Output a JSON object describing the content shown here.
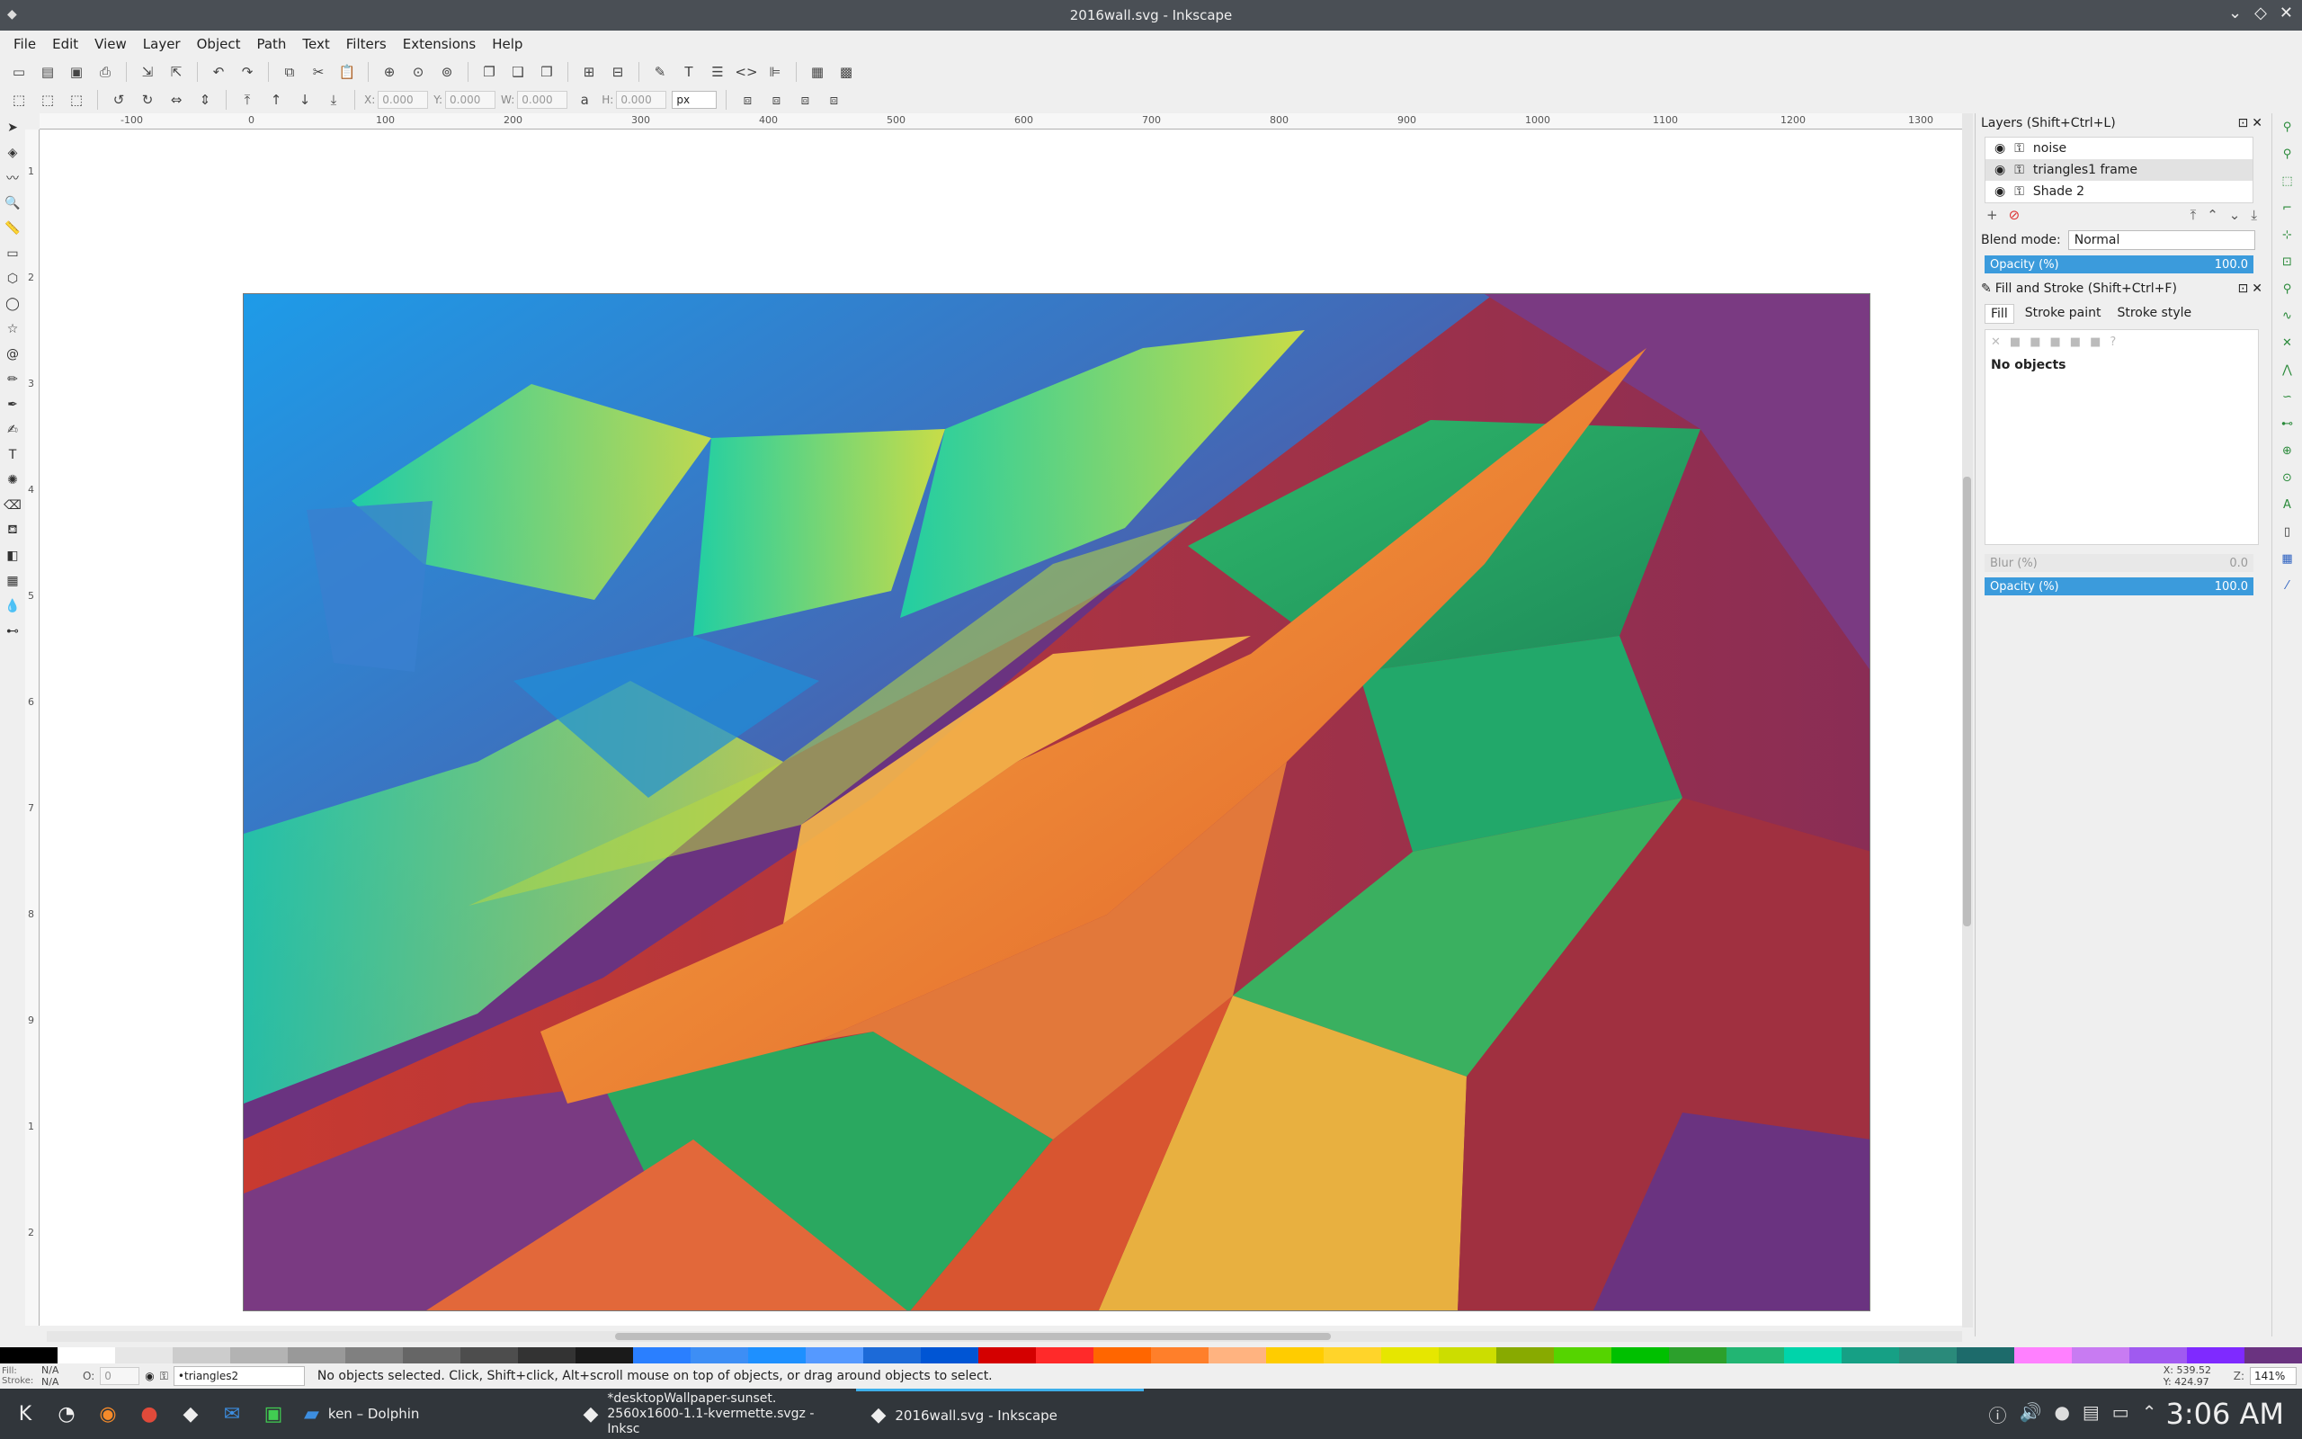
{
  "window": {
    "title": "2016wall.svg - Inkscape"
  },
  "menu": [
    "File",
    "Edit",
    "View",
    "Layer",
    "Object",
    "Path",
    "Text",
    "Filters",
    "Extensions",
    "Help"
  ],
  "controls": {
    "x_label": "X:",
    "x_value": "0.000",
    "y_label": "Y:",
    "y_value": "0.000",
    "w_label": "W:",
    "w_value": "0.000",
    "h_label": "H:",
    "h_value": "0.000",
    "unit": "px"
  },
  "ruler": {
    "h_ticks": [
      "-100",
      "0",
      "100",
      "200",
      "300",
      "400",
      "500",
      "600",
      "700",
      "800",
      "900",
      "1000",
      "1100",
      "1200",
      "1300"
    ],
    "v_ticks": [
      "1",
      "2",
      "3",
      "4",
      "5",
      "6",
      "7",
      "8",
      "9",
      "1",
      "2"
    ]
  },
  "layers_panel": {
    "title": "Layers (Shift+Ctrl+L)",
    "layers": [
      "noise",
      "triangles1 frame",
      "Shade 2"
    ],
    "blend_label": "Blend mode:",
    "blend_value": "Normal",
    "opacity_label": "Opacity (%)",
    "opacity_value": "100.0"
  },
  "fill_panel": {
    "title": "Fill and Stroke (Shift+Ctrl+F)",
    "tabs": [
      "Fill",
      "Stroke paint",
      "Stroke style"
    ],
    "status": "No objects",
    "blur_label": "Blur (%)",
    "blur_value": "0.0",
    "opacity_label": "Opacity (%)",
    "opacity_value": "100.0"
  },
  "status": {
    "fill_label": "Fill:",
    "fill_value": "N/A",
    "stroke_label": "Stroke:",
    "stroke_value": "N/A",
    "o_label": "O:",
    "o_value": "0",
    "layer": "•triangles2",
    "message": "No objects selected. Click, Shift+click, Alt+scroll mouse on top of objects, or drag around objects to select.",
    "x": "X:  539.52",
    "y": "Y:  424.97",
    "z_label": "Z:",
    "zoom": "141%"
  },
  "palette": [
    "#000000",
    "#ffffff",
    "#e6e6e6",
    "#cccccc",
    "#b3b3b3",
    "#999999",
    "#808080",
    "#666666",
    "#4d4d4d",
    "#333333",
    "#1a1a1a",
    "#2a7fff",
    "#3d8ef5",
    "#1e90ff",
    "#5599ff",
    "#1c6ad8",
    "#0055d4",
    "#d40000",
    "#ff2a2a",
    "#ff6600",
    "#ff7f2a",
    "#ffb380",
    "#ffcc00",
    "#ffd42a",
    "#e6e600",
    "#ccdd00",
    "#88aa00",
    "#55d400",
    "#00c000",
    "#2ca02c",
    "#22b573",
    "#00d4aa",
    "#16a085",
    "#2a8a7a",
    "#1d6b6b",
    "#ff80ff",
    "#c87bf2",
    "#a05af0",
    "#7f2aff",
    "#6a3380"
  ],
  "taskbar": {
    "tasks": [
      {
        "label": "ken – Dolphin"
      },
      {
        "label": "*desktopWallpaper-sunset. 2560x1600-1.1-kvermette.svgz - Inksc"
      },
      {
        "label": "2016wall.svg - Inkscape"
      }
    ],
    "clock": "3:06 AM"
  },
  "colors": {
    "accent": "#3b9bdc",
    "titlebar": "#4a4f55",
    "taskbar": "#31363b"
  }
}
